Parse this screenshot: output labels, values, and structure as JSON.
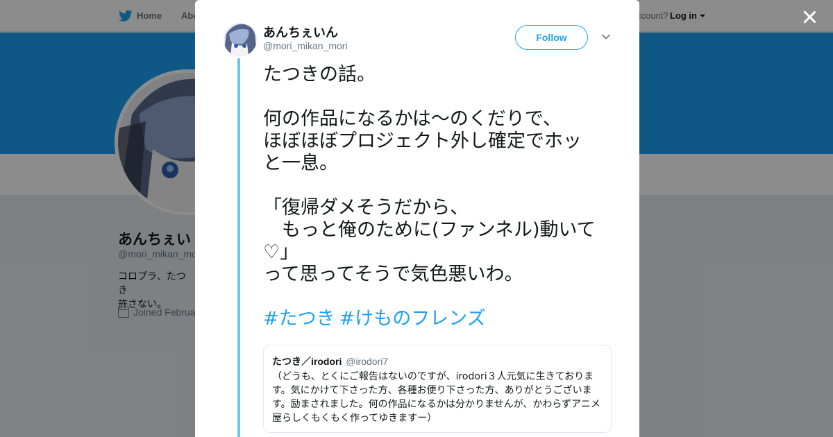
{
  "background": {
    "nav": {
      "home_label": "Home",
      "about_label": "Abo",
      "account_prompt": "ccount?",
      "login_label": "Log in"
    },
    "profile": {
      "display_name": "あんちぇい",
      "handle": "@mori_mikan_mo",
      "bio": "コロプラ、たつき\n許さない。",
      "joined": "Joined Februa"
    }
  },
  "modal": {
    "author": {
      "display_name": "あんちぇいん",
      "handle": "@mori_mikan_mori",
      "follow_label": "Follow"
    },
    "tweet": {
      "text": "たつきの話。\n\n何の作品になるかは〜のくだりで、\nほぼほぼプロジェクト外し確定でホッ\nと一息。\n\n「復帰ダメそうだから、\n　もっと俺のために(ファンネル)動いて\n♡」\nって思ってそうで気色悪いわ。",
      "hashtags": [
        "#たつき",
        "#けものフレンズ"
      ]
    },
    "quoted_tweet": {
      "display_name": "たつき／irodori",
      "handle": "@irodori7",
      "text": "（どうも、とくにご報告はないのですが、irodori３人元気に生きております。気にかけて下さった方、各種お便り下さった方、ありがとうございます。励まされました。何の作品になるかは分かりませんが、かわらずアニメ屋らしくもくもく作ってゆきますー）"
    }
  },
  "icons": {
    "brand": "twitter-bird-icon",
    "close": "close-icon",
    "dropdown": "chevron-down-icon",
    "calendar": "calendar-icon"
  },
  "colors": {
    "accent": "#1da1f2",
    "thread_line": "#6fc3f3",
    "text_primary": "#14171a",
    "text_secondary": "#657786"
  }
}
